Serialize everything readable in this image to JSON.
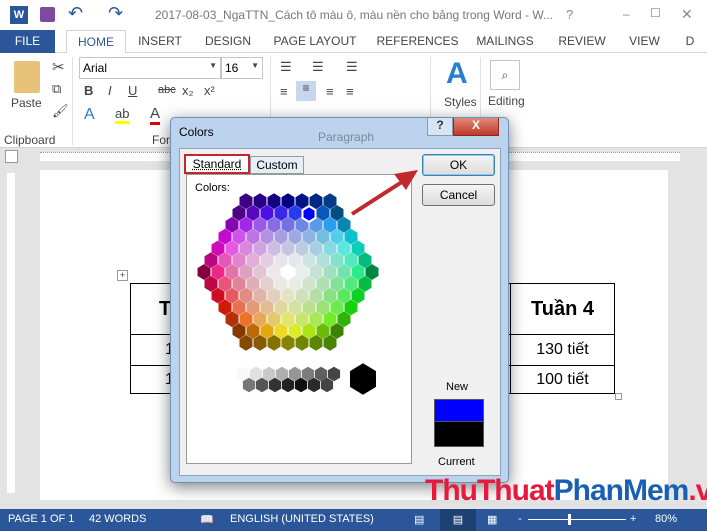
{
  "window": {
    "title": "2017-08-03_NgaTTN_Cách tô màu ô, màu nền cho bảng trong Word - W...",
    "help": "?",
    "minimize": "–",
    "maximize": "☐",
    "close": "✕"
  },
  "tabs": [
    "FILE",
    "HOME",
    "INSERT",
    "DESIGN",
    "PAGE LAYOUT",
    "REFERENCES",
    "MAILINGS",
    "REVIEW",
    "VIEW",
    "D"
  ],
  "ribbon": {
    "paste": "Paste",
    "font_name": "Arial",
    "font_size": "16",
    "bold": "B",
    "italic": "I",
    "underline": "U",
    "strike": "abc",
    "subscript": "x₂",
    "superscript": "x²",
    "styles": "Styles",
    "editing": "Editing",
    "group_clipboard": "Clipboard",
    "group_font": "Font",
    "group_paragraph": "Paragraph"
  },
  "table": {
    "header": [
      "T",
      "Tuần 4"
    ],
    "rows": [
      [
        "1",
        "130 tiết"
      ],
      [
        "1",
        "100 tiết"
      ]
    ]
  },
  "dialog": {
    "title": "Colors",
    "help": "?",
    "close": "X",
    "tab_standard": "Standard",
    "tab_custom": "Custom",
    "colors_label": "Colors:",
    "ok": "OK",
    "cancel": "Cancel",
    "new_label": "New",
    "current_label": "Current",
    "new_color": "#0000ff",
    "current_color": "#000000"
  },
  "status": {
    "page": "PAGE 1 OF 1",
    "words": "42 WORDS",
    "language": "ENGLISH (UNITED STATES)",
    "zoom": "80%"
  },
  "watermark": {
    "part1": "ThuThuat",
    "part2": "PhanMem",
    "part3": ".vn"
  },
  "colors": {
    "accent": "#2b579a",
    "arrow": "#c0282d"
  }
}
